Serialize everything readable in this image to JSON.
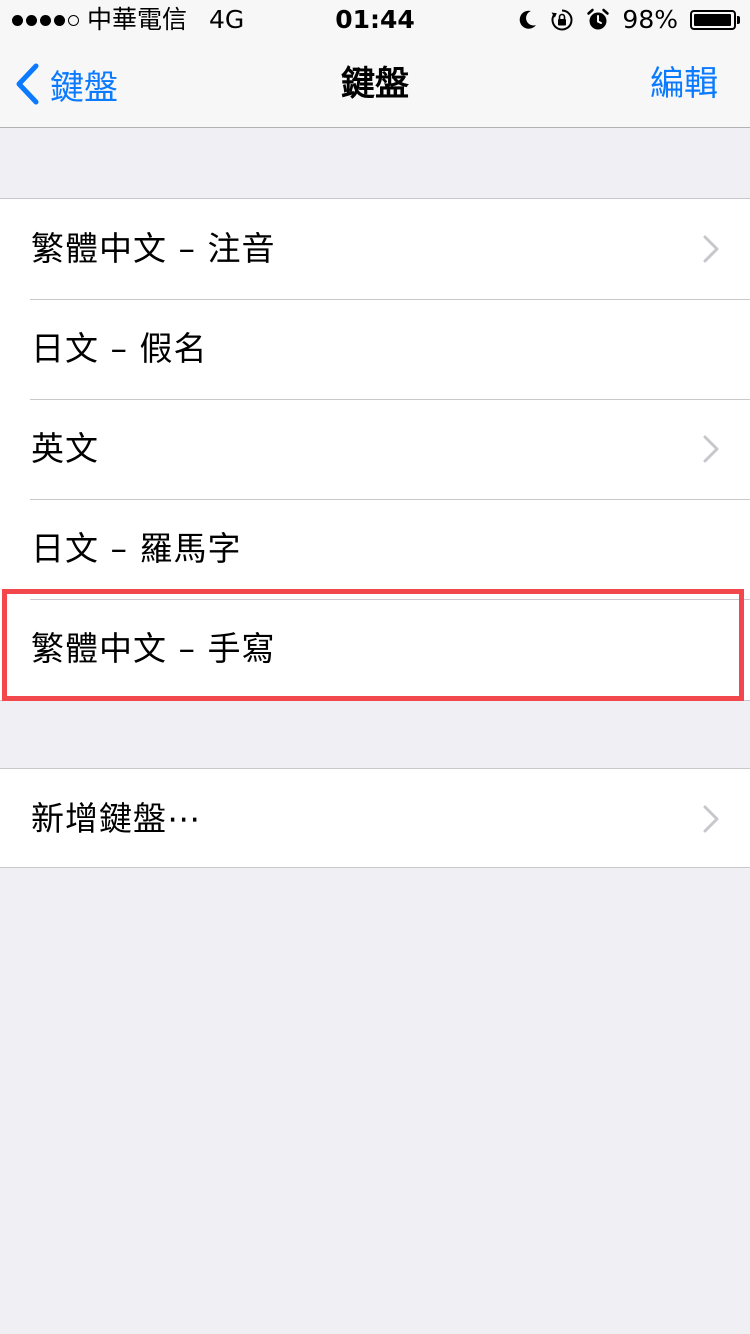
{
  "status_bar": {
    "signal_bars_filled": 4,
    "signal_bars_total": 5,
    "carrier": "中華電信",
    "network": "4G",
    "time": "01:44",
    "battery_percent_text": "98%",
    "battery_level": 0.98,
    "icons": [
      "moon-icon",
      "rotation-lock-icon",
      "alarm-icon",
      "battery-icon"
    ]
  },
  "nav": {
    "back_label": "鍵盤",
    "title": "鍵盤",
    "edit_label": "編輯"
  },
  "keyboards": [
    {
      "label": "繁體中文 – 注音",
      "has_chevron": true
    },
    {
      "label": "日文 – 假名",
      "has_chevron": false
    },
    {
      "label": "英文",
      "has_chevron": true
    },
    {
      "label": "日文 – 羅馬字",
      "has_chevron": false
    },
    {
      "label": "繁體中文 – 手寫",
      "has_chevron": false
    }
  ],
  "add_keyboard": {
    "label": "新增鍵盤⋯",
    "has_chevron": true
  },
  "colors": {
    "accent": "#0a7aff",
    "background": "#efeff4",
    "separator": "#c8c7cc",
    "highlight": "#f2474d",
    "chevron": "#c7c7cc"
  }
}
